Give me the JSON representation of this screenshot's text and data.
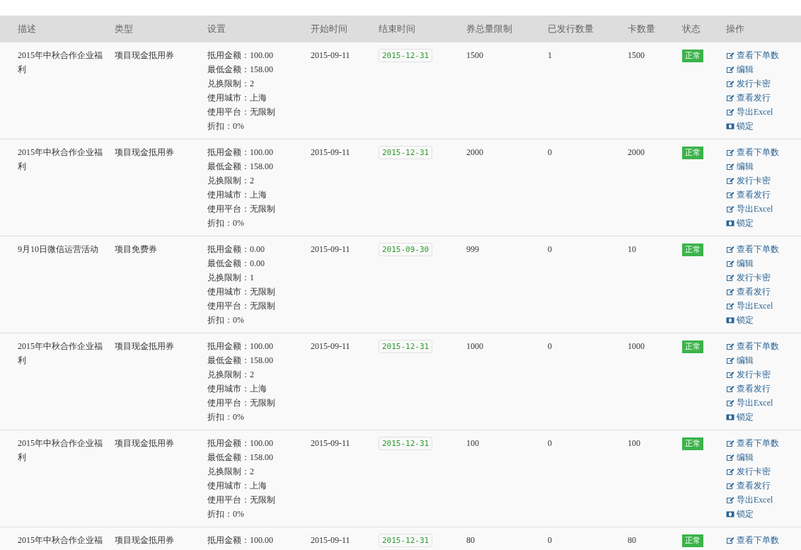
{
  "table": {
    "columns": [
      "描述",
      "类型",
      "设置",
      "开始时间",
      "结束时间",
      "券总量限制",
      "已发行数量",
      "卡数量",
      "状态",
      "操作"
    ],
    "rows": [
      {
        "description": "2015年中秋合作企业福利",
        "type": "项目现金抵用券",
        "settings": [
          "抵用金额：100.00",
          "最低金额：158.00",
          "兑换限制：2",
          "使用城市：上海",
          "使用平台：无限制",
          "折扣：0%"
        ],
        "start": "2015-09-11",
        "end": "2015-12-31",
        "total_limit": "1500",
        "issued": "1",
        "card_count": "1500",
        "status": {
          "label": "正常",
          "kind": "normal"
        },
        "actions": [
          {
            "label": "查看下单数",
            "kind": "edit"
          },
          {
            "label": "编辑",
            "kind": "edit"
          },
          {
            "label": "发行卡密",
            "kind": "edit"
          },
          {
            "label": "查看发行",
            "kind": "edit"
          },
          {
            "label": "导出Excel",
            "kind": "edit"
          },
          {
            "label": "锁定",
            "kind": "lock"
          }
        ]
      },
      {
        "description": "2015年中秋合作企业福利",
        "type": "项目现金抵用券",
        "settings": [
          "抵用金额：100.00",
          "最低金额：158.00",
          "兑换限制：2",
          "使用城市：上海",
          "使用平台：无限制",
          "折扣：0%"
        ],
        "start": "2015-09-11",
        "end": "2015-12-31",
        "total_limit": "2000",
        "issued": "0",
        "card_count": "2000",
        "status": {
          "label": "正常",
          "kind": "normal"
        },
        "actions": [
          {
            "label": "查看下单数",
            "kind": "edit"
          },
          {
            "label": "编辑",
            "kind": "edit"
          },
          {
            "label": "发行卡密",
            "kind": "edit"
          },
          {
            "label": "查看发行",
            "kind": "edit"
          },
          {
            "label": "导出Excel",
            "kind": "edit"
          },
          {
            "label": "锁定",
            "kind": "lock"
          }
        ]
      },
      {
        "description": "9月10日微信运营活动",
        "type": "项目免费券",
        "settings": [
          "抵用金额：0.00",
          "最低金额：0.00",
          "兑换限制：1",
          "使用城市：无限制",
          "使用平台：无限制",
          "折扣：0%"
        ],
        "start": "2015-09-11",
        "end": "2015-09-30",
        "total_limit": "999",
        "issued": "0",
        "card_count": "10",
        "status": {
          "label": "正常",
          "kind": "normal"
        },
        "actions": [
          {
            "label": "查看下单数",
            "kind": "edit"
          },
          {
            "label": "编辑",
            "kind": "edit"
          },
          {
            "label": "发行卡密",
            "kind": "edit"
          },
          {
            "label": "查看发行",
            "kind": "edit"
          },
          {
            "label": "导出Excel",
            "kind": "edit"
          },
          {
            "label": "锁定",
            "kind": "lock"
          }
        ]
      },
      {
        "description": "2015年中秋合作企业福利",
        "type": "项目现金抵用券",
        "settings": [
          "抵用金额：100.00",
          "最低金额：158.00",
          "兑换限制：2",
          "使用城市：上海",
          "使用平台：无限制",
          "折扣：0%"
        ],
        "start": "2015-09-11",
        "end": "2015-12-31",
        "total_limit": "1000",
        "issued": "0",
        "card_count": "1000",
        "status": {
          "label": "正常",
          "kind": "normal"
        },
        "actions": [
          {
            "label": "查看下单数",
            "kind": "edit"
          },
          {
            "label": "编辑",
            "kind": "edit"
          },
          {
            "label": "发行卡密",
            "kind": "edit"
          },
          {
            "label": "查看发行",
            "kind": "edit"
          },
          {
            "label": "导出Excel",
            "kind": "edit"
          },
          {
            "label": "锁定",
            "kind": "lock"
          }
        ]
      },
      {
        "description": "2015年中秋合作企业福利",
        "type": "项目现金抵用券",
        "settings": [
          "抵用金额：100.00",
          "最低金额：158.00",
          "兑换限制：2",
          "使用城市：上海",
          "使用平台：无限制",
          "折扣：0%"
        ],
        "start": "2015-09-11",
        "end": "2015-12-31",
        "total_limit": "100",
        "issued": "0",
        "card_count": "100",
        "status": {
          "label": "正常",
          "kind": "normal"
        },
        "actions": [
          {
            "label": "查看下单数",
            "kind": "edit"
          },
          {
            "label": "编辑",
            "kind": "edit"
          },
          {
            "label": "发行卡密",
            "kind": "edit"
          },
          {
            "label": "查看发行",
            "kind": "edit"
          },
          {
            "label": "导出Excel",
            "kind": "edit"
          },
          {
            "label": "锁定",
            "kind": "lock"
          }
        ]
      },
      {
        "description": "2015年中秋合作企业福",
        "type": "项目现金抵用券",
        "settings": [
          "抵用金额：100.00"
        ],
        "start": "2015-09-11",
        "end": "2015-12-31",
        "total_limit": "80",
        "issued": "0",
        "card_count": "80",
        "status": {
          "label": "正常",
          "kind": "normal"
        },
        "actions": [
          {
            "label": "查看下单数",
            "kind": "edit"
          }
        ]
      }
    ]
  }
}
